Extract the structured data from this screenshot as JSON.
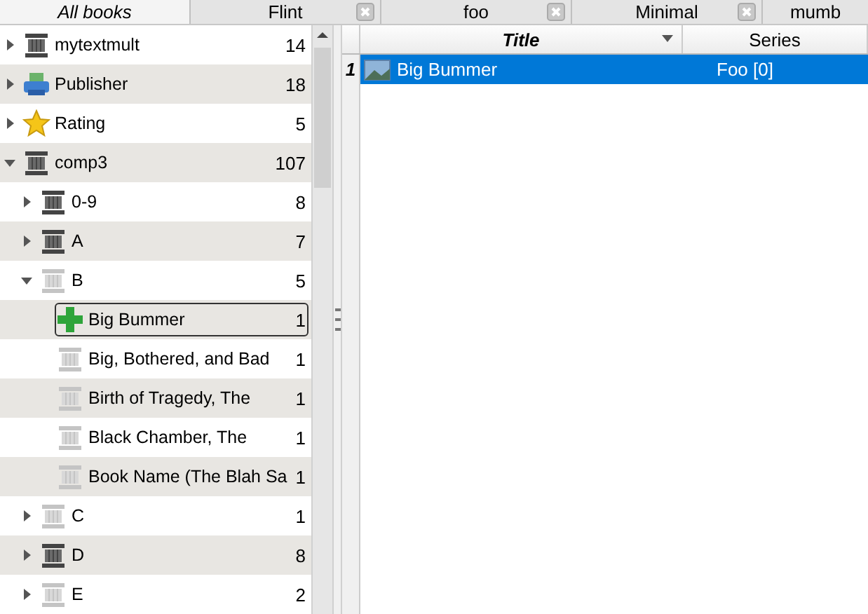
{
  "tabs": [
    {
      "label": "All books",
      "selected": true,
      "closable": false
    },
    {
      "label": "Flint",
      "selected": false,
      "closable": true
    },
    {
      "label": "foo",
      "selected": false,
      "closable": true
    },
    {
      "label": "Minimal",
      "selected": false,
      "closable": true
    },
    {
      "label": "mumb",
      "selected": false,
      "closable": false
    }
  ],
  "tree": [
    {
      "label": "mytextmult",
      "count": "14",
      "kind": "pillar",
      "faded": false,
      "expanded": false,
      "selected": false
    },
    {
      "label": "Publisher",
      "count": "18",
      "kind": "printer",
      "expanded": false,
      "selected": false
    },
    {
      "label": "Rating",
      "count": "5",
      "kind": "star",
      "expanded": false,
      "selected": false
    },
    {
      "label": "comp3",
      "count": "107",
      "kind": "pillar",
      "faded": false,
      "expanded": true,
      "selected": false,
      "children": [
        {
          "label": "0-9",
          "count": "8",
          "kind": "pillar",
          "faded": false,
          "expanded": false,
          "selected": false
        },
        {
          "label": "A",
          "count": "7",
          "kind": "pillar",
          "faded": false,
          "expanded": false,
          "selected": false
        },
        {
          "label": "B",
          "count": "5",
          "kind": "pillar",
          "faded": true,
          "expanded": true,
          "selected": false,
          "children": [
            {
              "label": "Big Bummer",
              "count": "1",
              "kind": "plus",
              "selected": true
            },
            {
              "label": "Big, Bothered, and Bad",
              "count": "1",
              "kind": "pillar",
              "faded": true,
              "selected": false
            },
            {
              "label": "Birth of Tragedy, The",
              "count": "1",
              "kind": "pillar",
              "faded": true,
              "selected": false
            },
            {
              "label": "Black Chamber, The",
              "count": "1",
              "kind": "pillar",
              "faded": true,
              "selected": false
            },
            {
              "label": "Book Name (The Blah Sa",
              "count": "1",
              "kind": "pillar",
              "faded": true,
              "selected": false
            }
          ]
        },
        {
          "label": "C",
          "count": "1",
          "kind": "pillar",
          "faded": true,
          "expanded": false,
          "selected": false
        },
        {
          "label": "D",
          "count": "8",
          "kind": "pillar",
          "faded": false,
          "expanded": false,
          "selected": false
        },
        {
          "label": "E",
          "count": "2",
          "kind": "pillar",
          "faded": true,
          "expanded": false,
          "selected": false
        }
      ]
    }
  ],
  "table": {
    "columns": [
      {
        "label": "Title",
        "sorted": true
      },
      {
        "label": "Series",
        "sorted": false
      }
    ],
    "rows": [
      {
        "number": "1",
        "title": "Big Bummer",
        "series": "Foo [0]",
        "selected": true
      }
    ]
  }
}
